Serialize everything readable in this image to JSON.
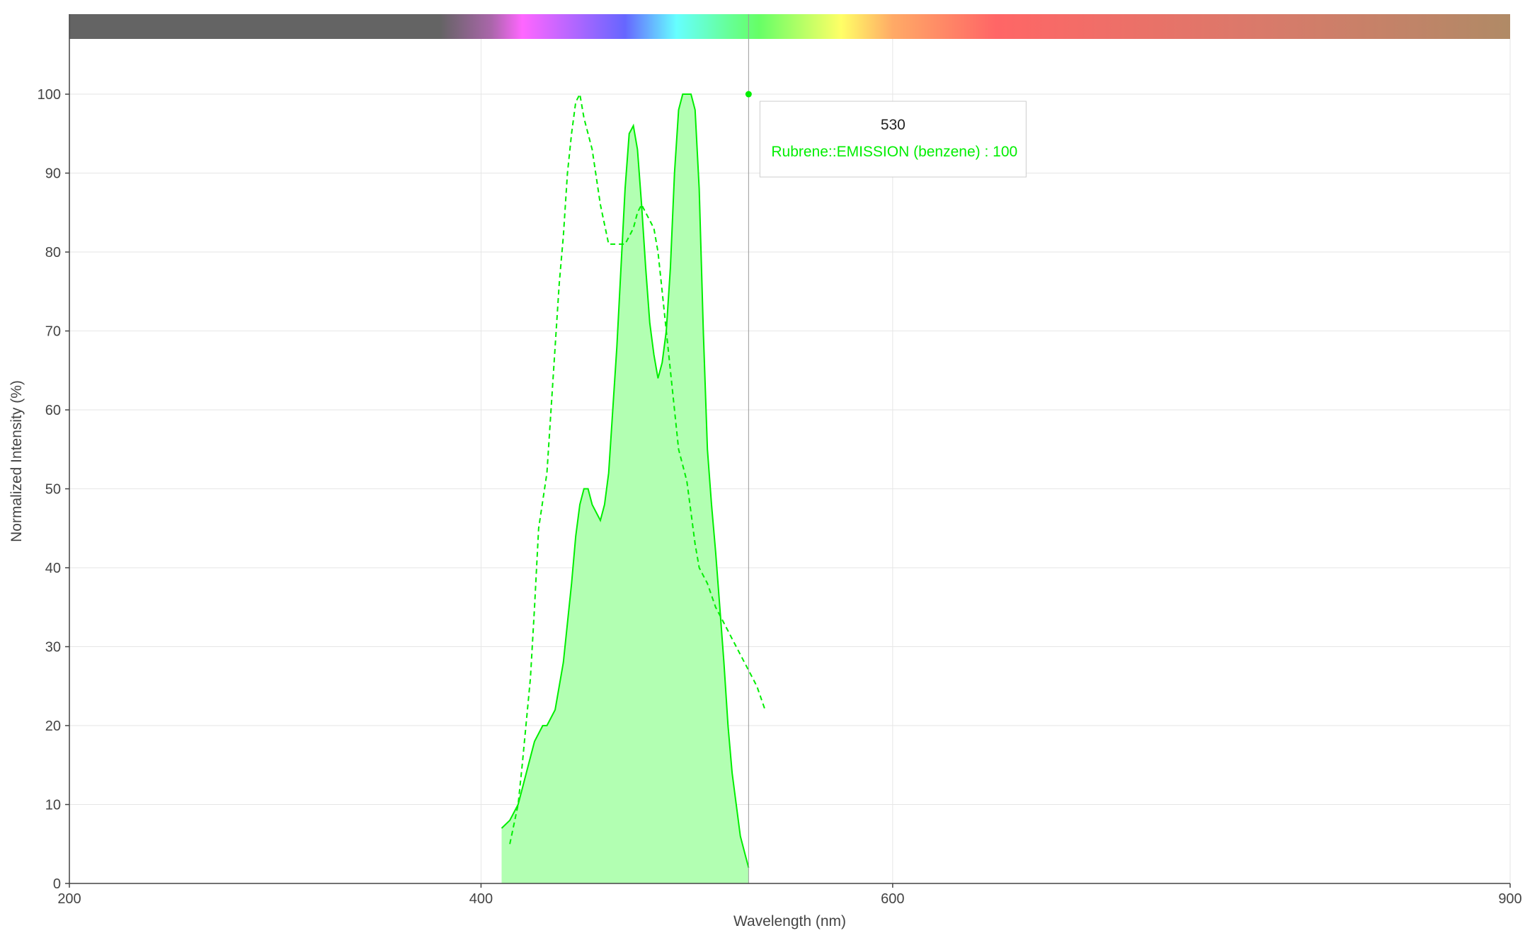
{
  "chart_data": {
    "type": "area",
    "xlabel": "Wavelength (nm)",
    "ylabel": "Normalized Intensity (%)",
    "xlim": [
      200,
      900
    ],
    "ylim": [
      0,
      107
    ],
    "x_ticks": [
      200,
      400,
      600,
      900
    ],
    "y_ticks": [
      0,
      10,
      20,
      30,
      40,
      50,
      60,
      70,
      80,
      90,
      100
    ],
    "grid": true,
    "color_strip": {
      "stops": [
        {
          "nm": 200,
          "color": "#646464"
        },
        {
          "nm": 380,
          "color": "#646464"
        },
        {
          "nm": 405,
          "color": "#aa66aa"
        },
        {
          "nm": 420,
          "color": "#ff66ff"
        },
        {
          "nm": 470,
          "color": "#6666ff"
        },
        {
          "nm": 495,
          "color": "#66ffff"
        },
        {
          "nm": 520,
          "color": "#66ff99"
        },
        {
          "nm": 535,
          "color": "#66ff66"
        },
        {
          "nm": 575,
          "color": "#ffff66"
        },
        {
          "nm": 600,
          "color": "#ffaa66"
        },
        {
          "nm": 650,
          "color": "#ff6666"
        },
        {
          "nm": 780,
          "color": "#d97a6a"
        },
        {
          "nm": 900,
          "color": "#b08a66"
        }
      ]
    },
    "series": [
      {
        "name": "Rubrene::EMISSION (benzene)",
        "style": "solid-filled",
        "color": "#00ee00",
        "fill": "#b2ffb2",
        "x": [
          410,
          414,
          416,
          418,
          420,
          422,
          424,
          426,
          428,
          430,
          432,
          434,
          436,
          440,
          444,
          446,
          448,
          450,
          452,
          454,
          456,
          458,
          460,
          462,
          464,
          466,
          468,
          470,
          472,
          474,
          476,
          478,
          480,
          482,
          484,
          486,
          488,
          490,
          492,
          494,
          496,
          498,
          500,
          502,
          504,
          506,
          508,
          510,
          512,
          514,
          516,
          518,
          520,
          522,
          524,
          526,
          528,
          530,
          532,
          534,
          536,
          538,
          540,
          542,
          544,
          546,
          548,
          550,
          552,
          554,
          556,
          558,
          560,
          562,
          564,
          567
        ],
        "values": [
          7,
          8,
          9,
          10,
          12,
          14,
          16,
          18,
          19,
          20,
          20,
          21,
          22,
          28,
          38,
          44,
          48,
          50,
          50,
          48,
          47,
          46,
          48,
          52,
          60,
          68,
          78,
          88,
          95,
          96,
          93,
          86,
          78,
          71,
          67,
          64,
          66,
          70,
          78,
          90,
          98,
          100,
          100,
          100,
          98,
          88,
          70,
          55,
          48,
          42,
          35,
          28,
          20,
          14,
          10,
          6,
          4,
          2,
          0,
          0,
          0,
          0,
          0,
          0,
          0,
          0,
          0,
          0,
          0,
          0,
          0,
          0,
          0,
          0,
          0,
          0
        ],
        "valid_points": 58
      },
      {
        "name": "",
        "style": "dashed",
        "color": "#00ee00",
        "x": [
          414,
          418,
          420,
          424,
          426,
          428,
          432,
          434,
          436,
          438,
          440,
          442,
          444,
          446,
          448,
          450,
          454,
          458,
          462,
          466,
          470,
          474,
          476,
          478,
          480,
          482,
          484,
          486,
          488,
          490,
          492,
          494,
          496,
          498,
          500,
          502,
          504,
          506,
          510,
          514,
          518,
          522,
          526,
          530,
          534,
          538,
          542,
          546,
          550,
          554,
          558,
          562,
          566,
          570,
          574,
          578,
          582,
          586,
          590,
          594,
          598,
          602,
          606,
          610,
          614,
          618,
          622,
          626,
          630,
          634
        ],
        "values": [
          5,
          10,
          15,
          26,
          35,
          45,
          52,
          60,
          68,
          76,
          82,
          90,
          95,
          99,
          100,
          97,
          93,
          86,
          81,
          81,
          81,
          83,
          85,
          86,
          85,
          84,
          83,
          80,
          75,
          70,
          65,
          60,
          55,
          53,
          51,
          47,
          43,
          40,
          38,
          35,
          33,
          31,
          29,
          27,
          25,
          22,
          19,
          16,
          14,
          12,
          10,
          8,
          6,
          5,
          5,
          5,
          5,
          5,
          5,
          5,
          5,
          5,
          5,
          5,
          5,
          5,
          5,
          5,
          5,
          5
        ],
        "valid_points": 46
      }
    ],
    "hover": {
      "x": 530,
      "title": "530",
      "label": "Rubrene::EMISSION (benzene) : 100",
      "y": 100
    }
  }
}
